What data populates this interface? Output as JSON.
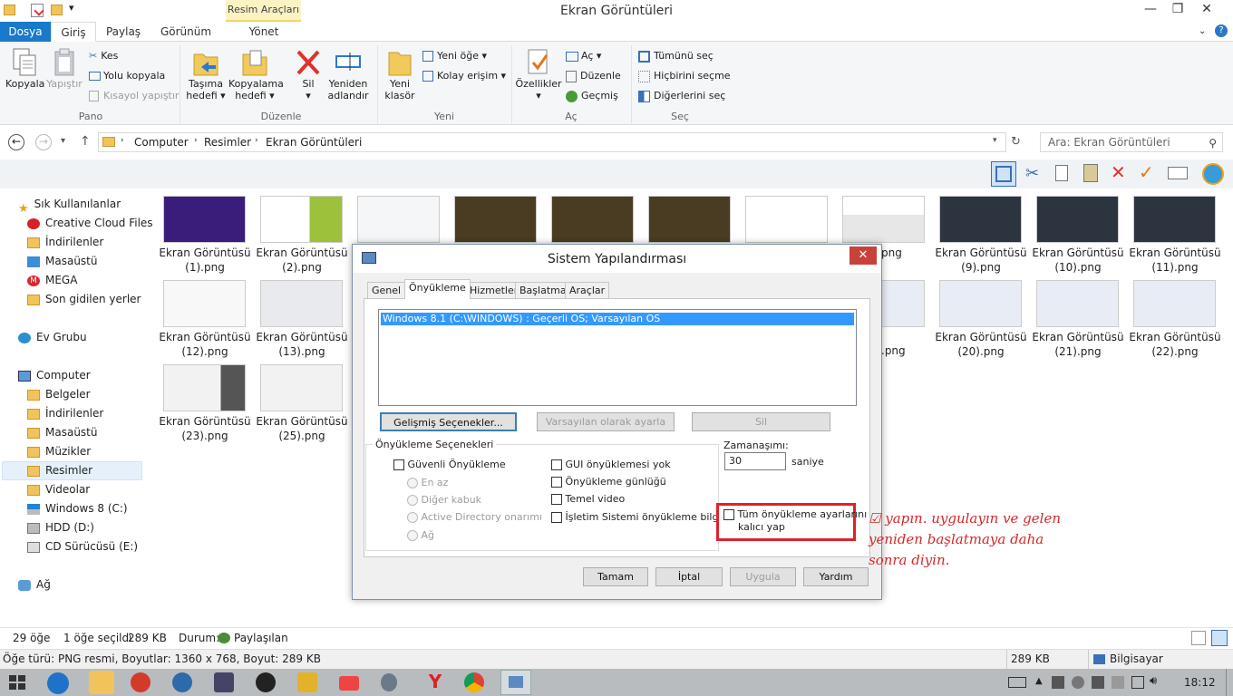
{
  "window": {
    "title": "Ekran Görüntüleri",
    "tool_tab": "Resim Araçları",
    "minimize": "—",
    "maximize": "❐",
    "close": "✕"
  },
  "tabs": {
    "dosya": "Dosya",
    "giris": "Giriş",
    "paylas": "Paylaş",
    "gorunum": "Görünüm",
    "yonet": "Yönet"
  },
  "ribbon": {
    "kopyala": "Kopyala",
    "yapistir": "Yapıştır",
    "kes": "Kes",
    "yolu_kopyala": "Yolu kopyala",
    "kisayol": "Kısayol yapıştır",
    "pano": "Pano",
    "tasima1": "Taşıma",
    "tasima2": "hedefi",
    "kopyalama1": "Kopyalama",
    "kopyalama2": "hedefi",
    "sil": "Sil",
    "yeniden1": "Yeniden",
    "yeniden2": "adlandır",
    "duzenle_grp": "Düzenle",
    "yeni_klasor1": "Yeni",
    "yeni_klasor2": "klasör",
    "yeni_oge": "Yeni öğe",
    "kolay_erisim": "Kolay erişim",
    "yeni_grp": "Yeni",
    "ozellikler": "Özellikler",
    "ac": "Aç",
    "duzenle": "Düzenle",
    "gecmis": "Geçmiş",
    "ac_grp": "Aç",
    "tumunu": "Tümünü seç",
    "hicbirini": "Hiçbirini seçme",
    "digerlerini": "Diğerlerini seç",
    "sec_grp": "Seç"
  },
  "address": {
    "crumbs": [
      "Computer",
      "Resimler",
      "Ekran Görüntüleri"
    ],
    "search_placeholder": "Ara: Ekran Görüntüleri"
  },
  "nav": {
    "fav": "Sık Kullanılanlar",
    "cc": "Creative Cloud Files",
    "indirilenler": "İndirilenler",
    "masaustu": "Masaüstü",
    "mega": "MEGA",
    "son": "Son gidilen yerler",
    "evgrubu": "Ev Grubu",
    "computer": "Computer",
    "belgeler": "Belgeler",
    "indirilenler2": "İndirilenler",
    "masaustu2": "Masaüstü",
    "muzikler": "Müzikler",
    "resimler": "Resimler",
    "videolar": "Videolar",
    "win8": "Windows 8 (C:)",
    "hdd": "HDD (D:)",
    "cd": "CD Sürücüsü (E:)",
    "ag": "Ağ"
  },
  "files": [
    {
      "l1": "Ekran Görüntüsü",
      "l2": "(1).png",
      "color": "#3a1d7a"
    },
    {
      "l1": "Ekran Görüntüsü",
      "l2": "(2).png",
      "color": "#9ec13c"
    },
    {
      "l1": "Ekran Görüntüsü",
      "l2": "(9).png",
      "color": "#2c3440"
    },
    {
      "l1": "Ekran Görüntüsü",
      "l2": "(10).png",
      "color": "#2c3440"
    },
    {
      "l1": "Ekran Görüntüsü",
      "l2": "(11).png",
      "color": "#2c3440"
    },
    {
      "l1": "Ekran Görüntüsü",
      "l2": "(12).png",
      "color": "#f8f8f8"
    },
    {
      "l1": "Ekran Görüntüsü",
      "l2": "(13).png",
      "color": "#e8eaee"
    },
    {
      "l1": "Ekran Görüntüsü",
      "l2": "(20).png",
      "color": "#e8ecf4"
    },
    {
      "l1": "Ekran Görüntüsü",
      "l2": "(21).png",
      "color": "#e8ecf4"
    },
    {
      "l1": "Ekran Görüntüsü",
      "l2": "(22).png",
      "color": "#e8ecf4"
    },
    {
      "l1": "Ekran Görüntüsü",
      "l2": "(23).png",
      "color": "#d8dbe0"
    },
    {
      "l1": "Ekran Görüntüsü",
      "l2": "(25).png",
      "color": "#f2f2f2"
    }
  ],
  "partial": {
    "r1": "png",
    "r2": ".png"
  },
  "status": {
    "count": "29 öğe",
    "selected": "1 öğe seçildi",
    "size": "289 KB",
    "durum_label": "Durum:",
    "durum_val": "Paylaşılan",
    "info": "Öğe türü: PNG resmi, Boyutlar: 1360 x 768, Boyut: 289 KB",
    "size2": "289 KB",
    "computer": "Bilgisayar"
  },
  "taskbar": {
    "clock": "18:12"
  },
  "dialog": {
    "title": "Sistem Yapılandırması",
    "tabs": [
      "Genel",
      "Önyükleme",
      "Hizmetler",
      "Başlatma",
      "Araçlar"
    ],
    "os_entry": "Windows 8.1 (C:\\WINDOWS) : Geçerli OS; Varsayılan OS",
    "btn_advanced": "Gelişmiş Seçenekler...",
    "btn_default": "Varsayılan olarak ayarla",
    "btn_delete": "Sil",
    "group_label": "Önyükleme Seçenekleri",
    "safe_boot": "Güvenli Önyükleme",
    "en_az": "En az",
    "diger_kabuk": "Diğer kabuk",
    "ad_onarim": "Active Directory onarımı",
    "ag": "Ağ",
    "gui": "GUI önyüklemesi yok",
    "gunluk": "Önyükleme günlüğü",
    "temel": "Temel video",
    "isletim": "İşletim Sistemi önyükleme bilgisi",
    "timeout_label": "Zamanaşımı:",
    "timeout_val": "30",
    "saniye": "saniye",
    "kalici1": "Tüm önyükleme ayarlarını",
    "kalici2": "kalıcı yap",
    "btn_tamam": "Tamam",
    "btn_iptal": "İptal",
    "btn_uygula": "Uygula",
    "btn_yardim": "Yardım"
  },
  "note": {
    "line1": "☑ yapın. uygulayın ve gelen",
    "line2": "yeniden başlatmaya daha",
    "line3": "sonra diyin."
  }
}
